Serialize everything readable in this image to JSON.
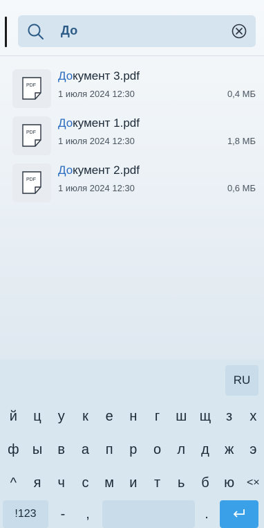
{
  "search": {
    "query": "До"
  },
  "files": [
    {
      "highlight": "До",
      "rest": "кумент 3.pdf",
      "date": "1 июля 2024 12:30",
      "size": "0,4 МБ",
      "thumb_label": "PDF"
    },
    {
      "highlight": "До",
      "rest": "кумент 1.pdf",
      "date": "1 июля 2024 12:30",
      "size": "1,8 МБ",
      "thumb_label": "PDF"
    },
    {
      "highlight": "До",
      "rest": "кумент 2.pdf",
      "date": "1 июля 2024 12:30",
      "size": "0,6 МБ",
      "thumb_label": "PDF"
    }
  ],
  "keyboard": {
    "lang": "RU",
    "row1": [
      "й",
      "ц",
      "у",
      "к",
      "е",
      "н",
      "г",
      "ш",
      "щ",
      "з",
      "х"
    ],
    "row2": [
      "ф",
      "ы",
      "в",
      "а",
      "п",
      "р",
      "о",
      "л",
      "д",
      "ж",
      "э"
    ],
    "row3": [
      "^",
      "я",
      "ч",
      "с",
      "м",
      "и",
      "т",
      "ь",
      "б",
      "ю",
      "<×"
    ],
    "row4": [
      "!123",
      "-",
      ",",
      "",
      ".",
      ""
    ],
    "colors": {
      "enter": "#3aa0e8",
      "key_bg": "#c8dde9",
      "keyboard_bg": "#d8e6ef",
      "highlight": "#2a6cc0"
    }
  }
}
